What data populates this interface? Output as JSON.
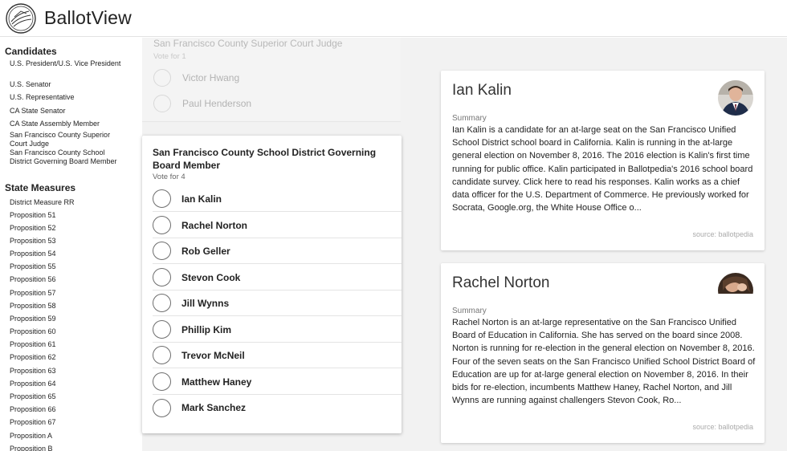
{
  "app": {
    "title": "BallotView"
  },
  "sidebar": {
    "candidates_title": "Candidates",
    "candidate_items": [
      "U.S. President/U.S. Vice President",
      "U.S. Senator",
      "U.S. Representative",
      "CA State Senator",
      "CA State Assembly Member",
      "San Francisco County Superior Court Judge",
      "San Francisco County School District Governing Board Member"
    ],
    "measures_title": "State Measures",
    "measure_items": [
      "District Measure RR",
      "Proposition 51",
      "Proposition 52",
      "Proposition 53",
      "Proposition 54",
      "Proposition 55",
      "Proposition 56",
      "Proposition 57",
      "Proposition 58",
      "Proposition 59",
      "Proposition 60",
      "Proposition 61",
      "Proposition 62",
      "Proposition 63",
      "Proposition 64",
      "Proposition 65",
      "Proposition 66",
      "Proposition 67",
      "Proposition A",
      "Proposition B"
    ]
  },
  "faded_race": {
    "title": "San Francisco County Superior Court Judge",
    "vote_for": "Vote for 1",
    "options": [
      "Victor Hwang",
      "Paul Henderson"
    ]
  },
  "race": {
    "title": "San Francisco County School District Governing Board Member",
    "vote_for": "Vote for 4",
    "options": [
      "Ian Kalin",
      "Rachel Norton",
      "Rob Geller",
      "Stevon Cook",
      "Jill Wynns",
      "Phillip Kim",
      "Trevor McNeil",
      "Matthew Haney",
      "Mark Sanchez"
    ]
  },
  "candidates": [
    {
      "name": "Ian Kalin",
      "summary_label": "Summary",
      "summary": "Ian Kalin is a candidate for an at-large seat on the San Francisco Unified School District school board in California. Kalin is running in the at-large general election on November 8, 2016. The 2016 election is Kalin's first time running for public office. Kalin participated in Ballotpedia's 2016 school board candidate survey. Click here to read his responses. Kalin works as a chief data officer for the U.S. Department of Commerce. He previously worked for Socrata, Google.org, the White House Office o...",
      "source": "source: ballotpedia"
    },
    {
      "name": "Rachel Norton",
      "summary_label": "Summary",
      "summary": "Rachel Norton is an at-large representative on the San Francisco Unified Board of Education in California. She has served on the board since 2008. Norton is running for re-election in the general election on November 8, 2016. Four of the seven seats on the San Francisco Unified School District Board of Education are up for at-large general election on November 8, 2016. In their bids for re-election, incumbents Matthew Haney, Rachel Norton, and Jill Wynns are running against challengers Stevon Cook, Ro...",
      "source": "source: ballotpedia"
    }
  ],
  "colors": {
    "main_bg": "#f2f2f2",
    "radio_border": "#6e6e6e"
  }
}
